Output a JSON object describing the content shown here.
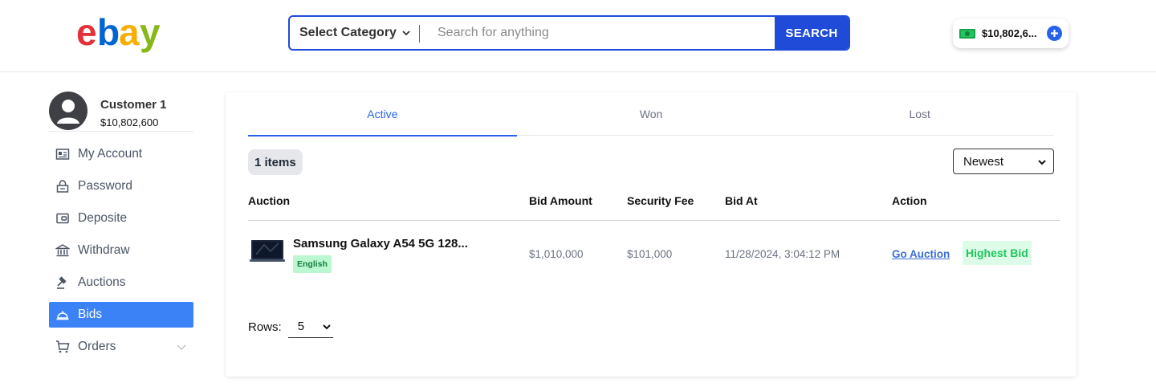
{
  "header": {
    "logo_letters": [
      "e",
      "b",
      "a",
      "y"
    ],
    "logo_colors": [
      "#e53238",
      "#0064d2",
      "#f5af02",
      "#86b817"
    ],
    "category_label": "Select Category",
    "search_placeholder": "Search for anything",
    "search_button": "SEARCH",
    "balance": "$10,802,6..."
  },
  "sidebar": {
    "user_name": "Customer 1",
    "user_balance": "$10,802,600",
    "items": [
      {
        "label": "My Account",
        "icon": "id-card-icon"
      },
      {
        "label": "Password",
        "icon": "lock-icon"
      },
      {
        "label": "Deposite",
        "icon": "wallet-icon"
      },
      {
        "label": "Withdraw",
        "icon": "bank-icon"
      },
      {
        "label": "Auctions",
        "icon": "gavel-icon"
      },
      {
        "label": "Bids",
        "icon": "bell-dome-icon",
        "active": true
      },
      {
        "label": "Orders",
        "icon": "cart-icon"
      }
    ]
  },
  "main": {
    "tabs": [
      {
        "label": "Active",
        "active": true
      },
      {
        "label": "Won"
      },
      {
        "label": "Lost"
      }
    ],
    "count": "1 items",
    "sort": "Newest",
    "columns": [
      "Auction",
      "Bid Amount",
      "Security Fee",
      "Bid At",
      "Action"
    ],
    "rows": [
      {
        "title": "Samsung Galaxy A54 5G 128...",
        "language": "English",
        "bid_amount": "$1,010,000",
        "security_fee": "$101,000",
        "bid_at": "11/28/2024, 3:04:12 PM",
        "action_link": "Go Auction",
        "status": "Highest Bid"
      }
    ],
    "rows_label": "Rows:",
    "rows_value": "5"
  },
  "colors": {
    "primary": "#1f4bd8",
    "active_nav": "#3b82f6",
    "tab_active": "#2563eb",
    "success": "#22c55e"
  }
}
